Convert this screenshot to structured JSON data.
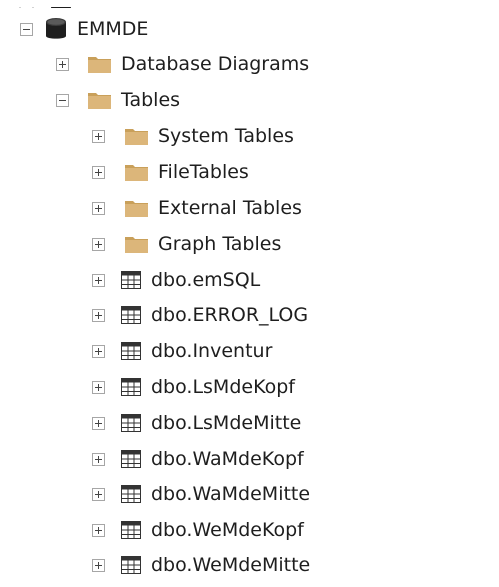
{
  "tree": {
    "database": {
      "label": "EMMDE",
      "icon": "database-icon",
      "expanded": true
    },
    "database_diagrams": {
      "label": "Database Diagrams",
      "icon": "folder-icon",
      "expanded": false
    },
    "tables": {
      "label": "Tables",
      "icon": "folder-icon",
      "expanded": true,
      "children": [
        {
          "label": "System Tables",
          "icon": "folder-icon",
          "expanded": false
        },
        {
          "label": "FileTables",
          "icon": "folder-icon",
          "expanded": false
        },
        {
          "label": "External Tables",
          "icon": "folder-icon",
          "expanded": false
        },
        {
          "label": "Graph Tables",
          "icon": "folder-icon",
          "expanded": false
        },
        {
          "label": "dbo.emSQL",
          "icon": "table-icon",
          "expanded": false
        },
        {
          "label": "dbo.ERROR_LOG",
          "icon": "table-icon",
          "expanded": false
        },
        {
          "label": "dbo.Inventur",
          "icon": "table-icon",
          "expanded": false
        },
        {
          "label": "dbo.LsMdeKopf",
          "icon": "table-icon",
          "expanded": false
        },
        {
          "label": "dbo.LsMdeMitte",
          "icon": "table-icon",
          "expanded": false
        },
        {
          "label": "dbo.WaMdeKopf",
          "icon": "table-icon",
          "expanded": false
        },
        {
          "label": "dbo.WaMdeMitte",
          "icon": "table-icon",
          "expanded": false
        },
        {
          "label": "dbo.WeMdeKopf",
          "icon": "table-icon",
          "expanded": false
        },
        {
          "label": "dbo.WeMdeMitte",
          "icon": "table-icon",
          "expanded": false
        }
      ]
    }
  },
  "colors": {
    "folder": "#dcb67a",
    "folder_dark": "#c9a05a",
    "database": "#1e1e1e",
    "table_icon": "#333333",
    "expander_border": "#a6a6a6"
  }
}
